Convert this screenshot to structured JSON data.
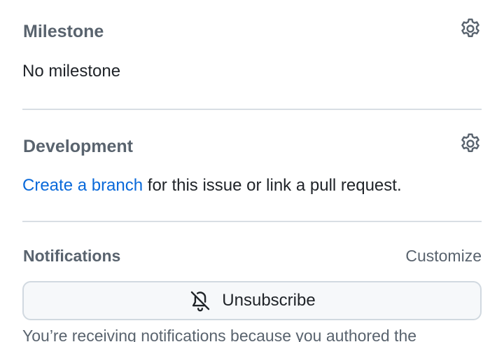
{
  "milestone": {
    "title": "Milestone",
    "value": "No milestone",
    "settings_icon": "gear-icon"
  },
  "development": {
    "title": "Development",
    "link_text": "Create a branch",
    "rest_text": " for this issue or link a pull request.",
    "settings_icon": "gear-icon"
  },
  "notifications": {
    "title": "Notifications",
    "customize_label": "Customize",
    "unsubscribe_label": "Unsubscribe",
    "unsubscribe_icon": "bell-slash-icon",
    "notice_text": "You’re receiving notifications because you authored the"
  },
  "colors": {
    "link": "#0969da",
    "muted": "#59636e",
    "text": "#1f2328",
    "divider": "#d8dee4",
    "button_bg": "#f6f8fa",
    "button_border": "#d1d9e0"
  }
}
